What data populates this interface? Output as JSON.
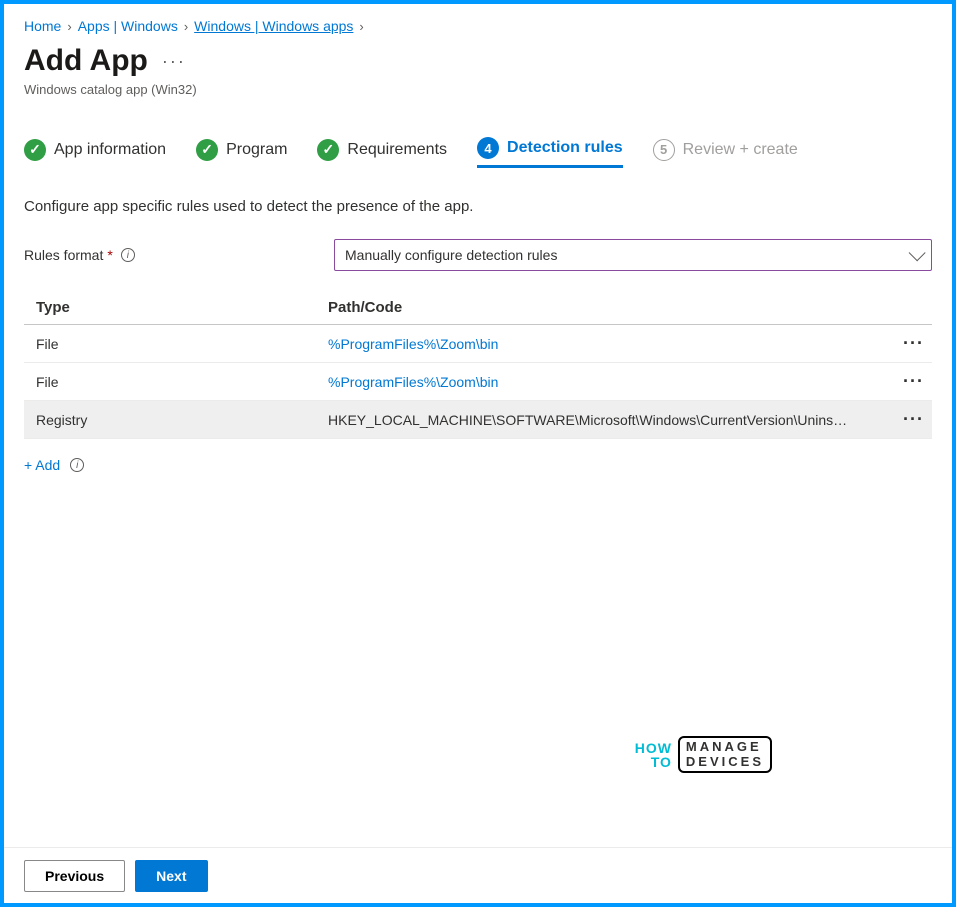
{
  "breadcrumb": {
    "home": "Home",
    "apps": "Apps | Windows",
    "winapps": "Windows | Windows apps"
  },
  "pageTitle": "Add App",
  "subtitle": "Windows catalog app (Win32)",
  "steps": {
    "s1": "App information",
    "s2": "Program",
    "s3": "Requirements",
    "s4": "Detection rules",
    "n4": "4",
    "s5": "Review + create",
    "n5": "5"
  },
  "description": "Configure app specific rules used to detect the presence of the app.",
  "formatLabel": "Rules format",
  "formatValue": "Manually configure detection rules",
  "table": {
    "head1": "Type",
    "head2": "Path/Code",
    "rows": [
      {
        "type": "File",
        "path": "%ProgramFiles%\\Zoom\\bin",
        "linkStyle": true
      },
      {
        "type": "File",
        "path": "%ProgramFiles%\\Zoom\\bin",
        "linkStyle": true
      },
      {
        "type": "Registry",
        "path": "HKEY_LOCAL_MACHINE\\SOFTWARE\\Microsoft\\Windows\\CurrentVersion\\Unins…",
        "linkStyle": false
      }
    ]
  },
  "addLabel": "+ Add",
  "watermark": {
    "left1": "HOW",
    "left2": "TO",
    "right1": "MANAGE",
    "right2": "DEVICES"
  },
  "buttons": {
    "prev": "Previous",
    "next": "Next"
  }
}
